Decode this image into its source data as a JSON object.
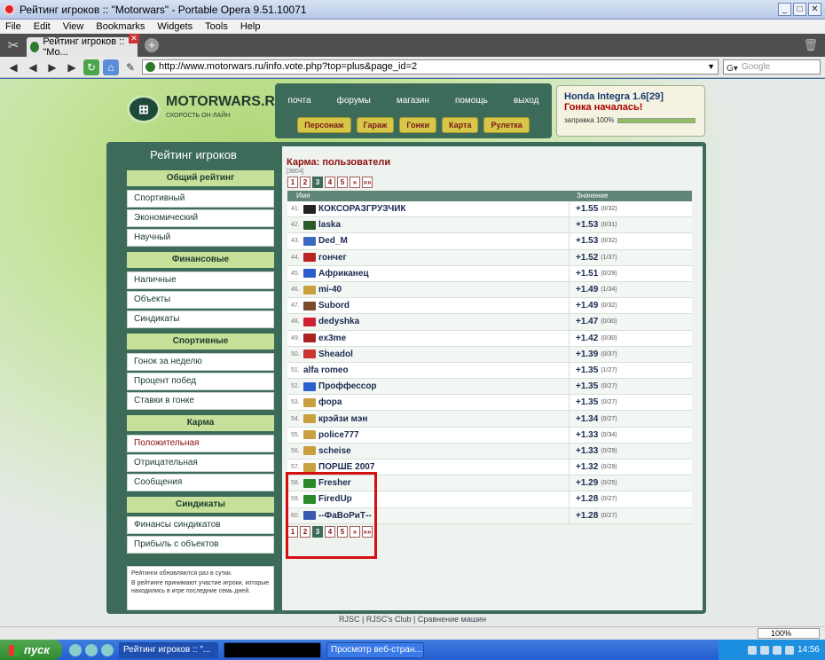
{
  "window": {
    "title": "Рейтинг игроков :: \"Motorwars\" - Portable Opera 9.51.10071"
  },
  "menu": [
    "File",
    "Edit",
    "View",
    "Bookmarks",
    "Widgets",
    "Tools",
    "Help"
  ],
  "tab": {
    "label": "Рейтинг игроков :: \"Mo..."
  },
  "address": {
    "url": "http://www.motorwars.ru/info.vote.php?top=plus&page_id=2",
    "search_placeholder": "Google"
  },
  "site": {
    "logo": "MOTORWARS.RU",
    "tagline": "СКОРОСТЬ ОН-ЛАЙН",
    "nav_links": [
      "почта",
      "форумы",
      "магазин",
      "помощь",
      "выход"
    ],
    "nav_buttons": [
      "Персонаж",
      "Гараж",
      "Гонки",
      "Карта",
      "Рулетка"
    ],
    "car": "Honda Integra 1.6[29]",
    "race_status": "Гонка началась!",
    "fuel_label": "заправка 100%",
    "fuel_fraction": 1.0
  },
  "sidebar": {
    "title": "Рейтинг игроков",
    "groups": [
      {
        "head": "Общий рейтинг",
        "items": [
          "Спортивный",
          "Экономический",
          "Научный"
        ]
      },
      {
        "head": "Финансовые",
        "items": [
          "Наличные",
          "Объекты",
          "Синдикаты"
        ]
      },
      {
        "head": "Спортивные",
        "items": [
          "Гонок за неделю",
          "Процент побед",
          "Ставки в гонке"
        ]
      },
      {
        "head": "Карма",
        "items": [
          "Положительная",
          "Отрицательная",
          "Сообщения"
        ]
      },
      {
        "head": "Синдикаты",
        "items": [
          "Финансы синдикатов",
          "Прибыль с объектов"
        ]
      }
    ],
    "notes": [
      "Рейтинги обновляются раз в сутки.",
      "В рейтинге принимают участие игроки, которые находились в игре последние семь дней."
    ]
  },
  "content": {
    "title": "Карма: пользователи",
    "count": "[3804]",
    "pages": [
      "1",
      "2",
      "3",
      "4",
      "5",
      "»",
      "»»"
    ],
    "current_page": "3",
    "col_name": "Имя",
    "col_value": "Значение",
    "rows": [
      {
        "n": "41.",
        "name": "КОКСОРАЗГРУЗЧИК",
        "val": "+1.55",
        "sub": "(0/32)",
        "av": "#222"
      },
      {
        "n": "42.",
        "name": "laska",
        "val": "+1.53",
        "sub": "(0/31)",
        "av": "#2a5a2a"
      },
      {
        "n": "43.",
        "name": "Ded_M",
        "val": "+1.53",
        "sub": "(0/32)",
        "av": "#3a6ac0"
      },
      {
        "n": "44.",
        "name": "гончег",
        "val": "+1.52",
        "sub": "(1/37)",
        "av": "#b22"
      },
      {
        "n": "45.",
        "name": "Африканец",
        "val": "+1.51",
        "sub": "(0/29)",
        "av": "#2a5fd0"
      },
      {
        "n": "46.",
        "name": "mi-40",
        "val": "+1.49",
        "sub": "(1/34)",
        "av": "#c8a040"
      },
      {
        "n": "47.",
        "name": "Subord",
        "val": "+1.49",
        "sub": "(0/32)",
        "av": "#7a4a2a"
      },
      {
        "n": "48.",
        "name": "dedyshka",
        "val": "+1.47",
        "sub": "(0/30)",
        "av": "#c23"
      },
      {
        "n": "49.",
        "name": "ex3me",
        "val": "+1.42",
        "sub": "(0/30)",
        "av": "#a22"
      },
      {
        "n": "50.",
        "name": "Sheadol",
        "val": "+1.39",
        "sub": "(0/37)",
        "av": "#c33"
      },
      {
        "n": "51.",
        "name": "alfa romeo",
        "val": "+1.35",
        "sub": "(1/27)",
        "av": ""
      },
      {
        "n": "52.",
        "name": "Проффессор",
        "val": "+1.35",
        "sub": "(0/27)",
        "av": "#2a5fd0"
      },
      {
        "n": "53.",
        "name": "фора",
        "val": "+1.35",
        "sub": "(0/27)",
        "av": "#c8a040"
      },
      {
        "n": "54.",
        "name": "крэйзи мэн",
        "val": "+1.34",
        "sub": "(0/27)",
        "av": "#c8a040"
      },
      {
        "n": "55.",
        "name": "police777",
        "val": "+1.33",
        "sub": "(0/34)",
        "av": "#c8a040"
      },
      {
        "n": "56.",
        "name": "scheise",
        "val": "+1.33",
        "sub": "(0/29)",
        "av": "#c8a040"
      },
      {
        "n": "57.",
        "name": "ПОРШЕ 2007",
        "val": "+1.32",
        "sub": "(0/29)",
        "av": "#c8a040"
      },
      {
        "n": "58.",
        "name": "Fresher",
        "val": "+1.29",
        "sub": "(0/25)",
        "av": "#2a8a2a"
      },
      {
        "n": "59.",
        "name": "FiredUp",
        "val": "+1.28",
        "sub": "(0/27)",
        "av": "#2a8a2a"
      },
      {
        "n": "60.",
        "name": "--ФаВоРиТ--",
        "val": "+1.28",
        "sub": "(0/27)",
        "av": "#3a5ab0"
      }
    ]
  },
  "footer": "RJSC | RJSC's Club | Сравнение машин",
  "status": {
    "zoom": "100%"
  },
  "taskbar": {
    "start": "пуск",
    "tasks": [
      "Рейтинг игроков :: \"...",
      "",
      "Просмотр веб-стран..."
    ],
    "clock": "14:56"
  }
}
